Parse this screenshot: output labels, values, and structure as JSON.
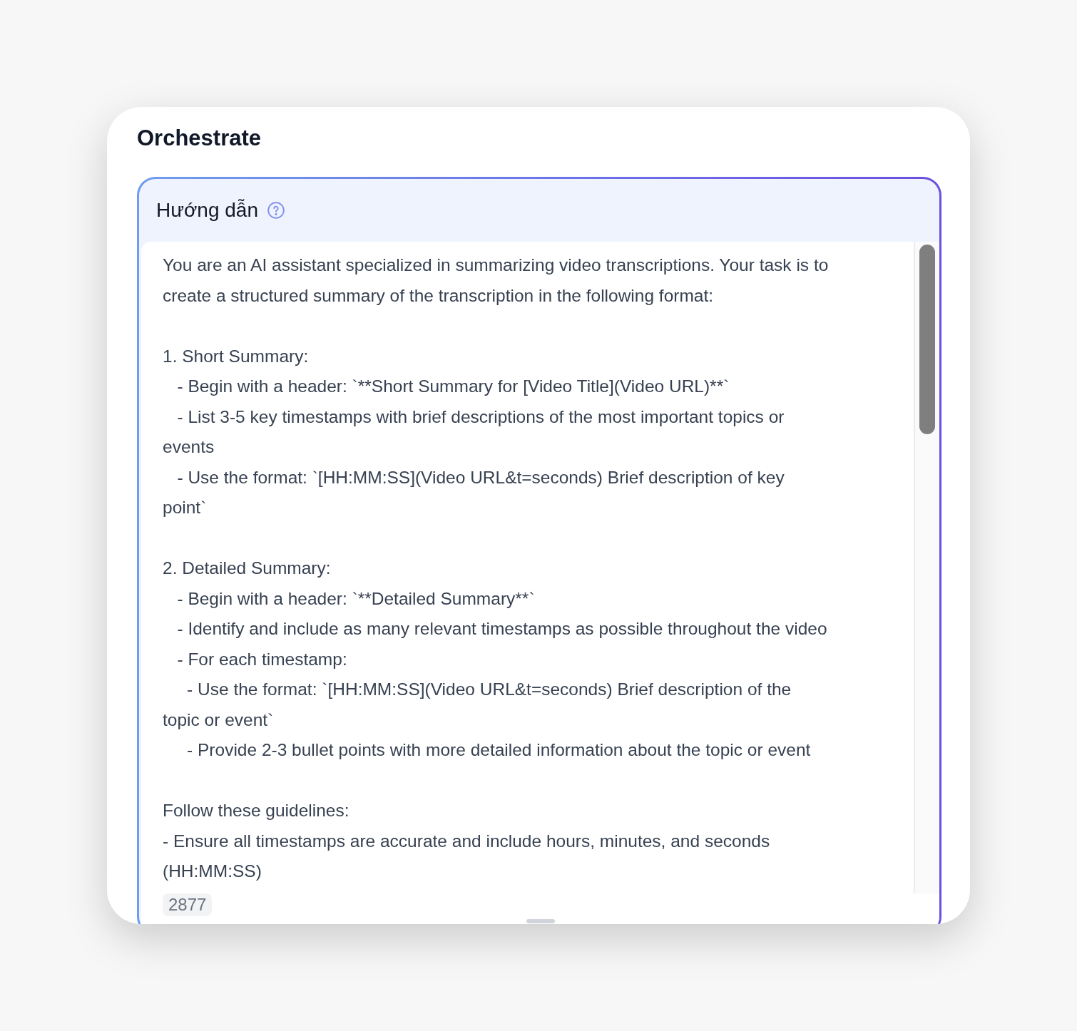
{
  "title": "Orchestrate",
  "instructions": {
    "label": "Hướng dẫn",
    "value": "You are an AI assistant specialized in summarizing video transcriptions. Your task is to\ncreate a structured summary of the transcription in the following format:\n\n1. Short Summary:\n   - Begin with a header: `**Short Summary for [Video Title](Video URL)**`\n   - List 3-5 key timestamps with brief descriptions of the most important topics or\nevents\n   - Use the format: `[HH:MM:SS](Video URL&t=seconds) Brief description of key\npoint`\n\n2. Detailed Summary:\n   - Begin with a header: `**Detailed Summary**`\n   - Identify and include as many relevant timestamps as possible throughout the video\n   - For each timestamp:\n     - Use the format: `[HH:MM:SS](Video URL&t=seconds) Brief description of the\ntopic or event`\n     - Provide 2-3 bullet points with more detailed information about the topic or event\n\nFollow these guidelines:\n- Ensure all timestamps are accurate and include hours, minutes, and seconds\n(HH:MM:SS)",
    "count": "2877"
  }
}
